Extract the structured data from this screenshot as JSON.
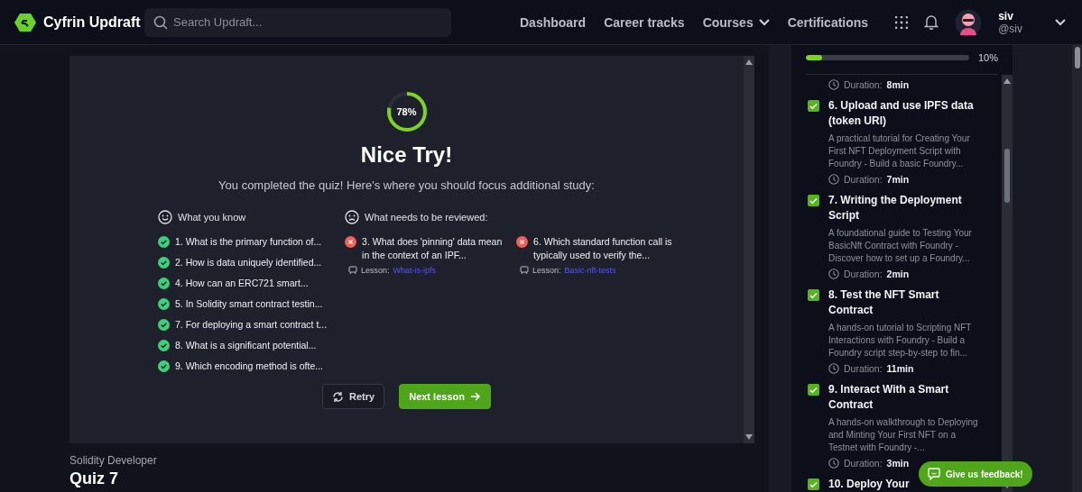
{
  "header": {
    "brand": "Cyfrin Updraft",
    "search": {
      "placeholder": "Search Updraft..."
    },
    "nav": [
      {
        "label": "Dashboard",
        "dropdown": false
      },
      {
        "label": "Career tracks",
        "dropdown": false
      },
      {
        "label": "Courses",
        "dropdown": true
      },
      {
        "label": "Certifications",
        "dropdown": false
      }
    ],
    "user": {
      "name": "siv",
      "handle": "@siv"
    }
  },
  "quiz_result": {
    "score": "78%",
    "level": 0.78,
    "title": "Nice Try!",
    "subtitle": "You completed the quiz! Here's where you should focus additional study:",
    "known": {
      "heading": "What you know",
      "items": [
        {
          "text": "1. What is the primary function of..."
        },
        {
          "text": "2. How is data uniquely identified..."
        },
        {
          "text": "4. How can an ERC721 smart..."
        },
        {
          "text": "5. In Solidity smart contract testin..."
        },
        {
          "text": "7. For deploying a smart contract t..."
        },
        {
          "text": "8. What is a significant potential..."
        },
        {
          "text": "9. Which encoding method is ofte..."
        }
      ]
    },
    "review": {
      "heading": "What needs to be reviewed:",
      "items": [
        {
          "text": "3. What does 'pinning' data mean in the context of an IPF...",
          "lesson_label": "Lesson:",
          "lesson": "What-is-ipfs"
        },
        {
          "text": "6. Which standard function call is typically used to verify the...",
          "lesson_label": "Lesson:",
          "lesson": "Basic-nft-tests"
        }
      ]
    },
    "buttons": [
      {
        "label": "Retry",
        "kind": "secondary"
      },
      {
        "label": "Next lesson",
        "kind": "primary"
      }
    ]
  },
  "breadcrumb": "Solidity Developer",
  "page_title": "Quiz 7",
  "sidebar": {
    "progress": {
      "level": 0.1,
      "reading": "10%"
    },
    "lessons": [
      {
        "duration_label": "Duration:",
        "duration": "8min"
      },
      {
        "completed": true,
        "title": "6. Upload and use IPFS data (token URI)",
        "description": "A practical tutorial for Creating Your First NFT Deployment Script with Foundry - Build a basic Foundry...",
        "duration_label": "Duration:",
        "duration": "7min"
      },
      {
        "completed": true,
        "title": "7. Writing the Deployment Script",
        "description": "A foundational guide to Testing Your BasicNft Contract with Foundry - Discover how to set up a Foundry...",
        "duration_label": "Duration:",
        "duration": "2min"
      },
      {
        "completed": true,
        "title": "8. Test the NFT Smart Contract",
        "description": "A hands-on tutorial to Scripting NFT Interactions with Foundry - Build a Foundry script step-by-step to fin...",
        "duration_label": "Duration:",
        "duration": "11min"
      },
      {
        "completed": true,
        "title": "9. Interact With a Smart Contract",
        "description": "A hands-on walkthrough to Deploying and Minting Your First NFT on a Testnet with Foundry -...",
        "duration_label": "Duration:",
        "duration": "3min"
      },
      {
        "completed": true,
        "title": "10. Deploy Your"
      }
    ]
  },
  "feedback": "Give us feedback!"
}
